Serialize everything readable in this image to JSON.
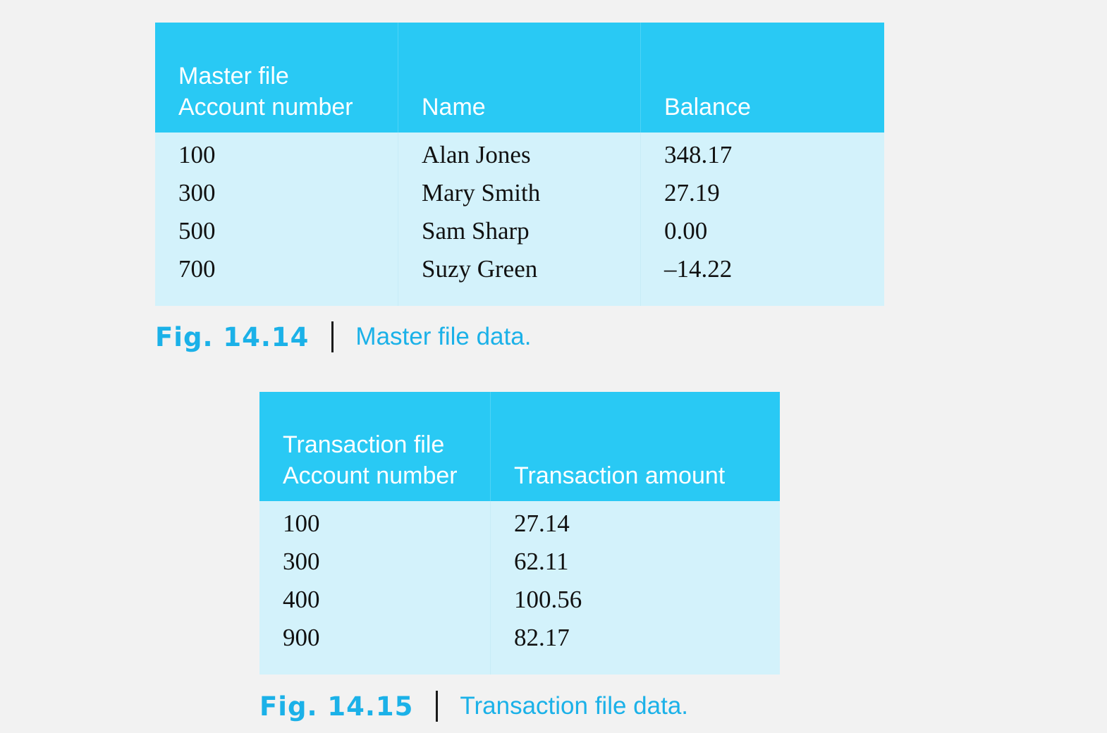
{
  "master_table": {
    "headers": [
      {
        "line1": "Master file",
        "line2": "Account number"
      },
      {
        "line1": "",
        "line2": "Name"
      },
      {
        "line1": "",
        "line2": "Balance"
      }
    ],
    "rows": [
      [
        "100",
        "Alan Jones",
        "348.17"
      ],
      [
        "300",
        "Mary Smith",
        "27.19"
      ],
      [
        "500",
        "Sam Sharp",
        "0.00"
      ],
      [
        "700",
        "Suzy Green",
        "–14.22"
      ]
    ]
  },
  "master_caption": {
    "figure": "Fig. 14.14",
    "text": "Master file data."
  },
  "transaction_table": {
    "headers": [
      {
        "line1": "Transaction file",
        "line2": "Account number"
      },
      {
        "line1": "",
        "line2": "Transaction amount"
      }
    ],
    "rows": [
      [
        "100",
        "27.14"
      ],
      [
        "300",
        "62.11"
      ],
      [
        "400",
        "100.56"
      ],
      [
        "900",
        "82.17"
      ]
    ]
  },
  "transaction_caption": {
    "figure": "Fig. 14.15",
    "text": "Transaction file data."
  },
  "colors": {
    "header_bg": "#29c9f4",
    "body_bg": "#d3f2fb",
    "caption_accent": "#1bb1e8",
    "page_bg": "#f2f2f2"
  }
}
